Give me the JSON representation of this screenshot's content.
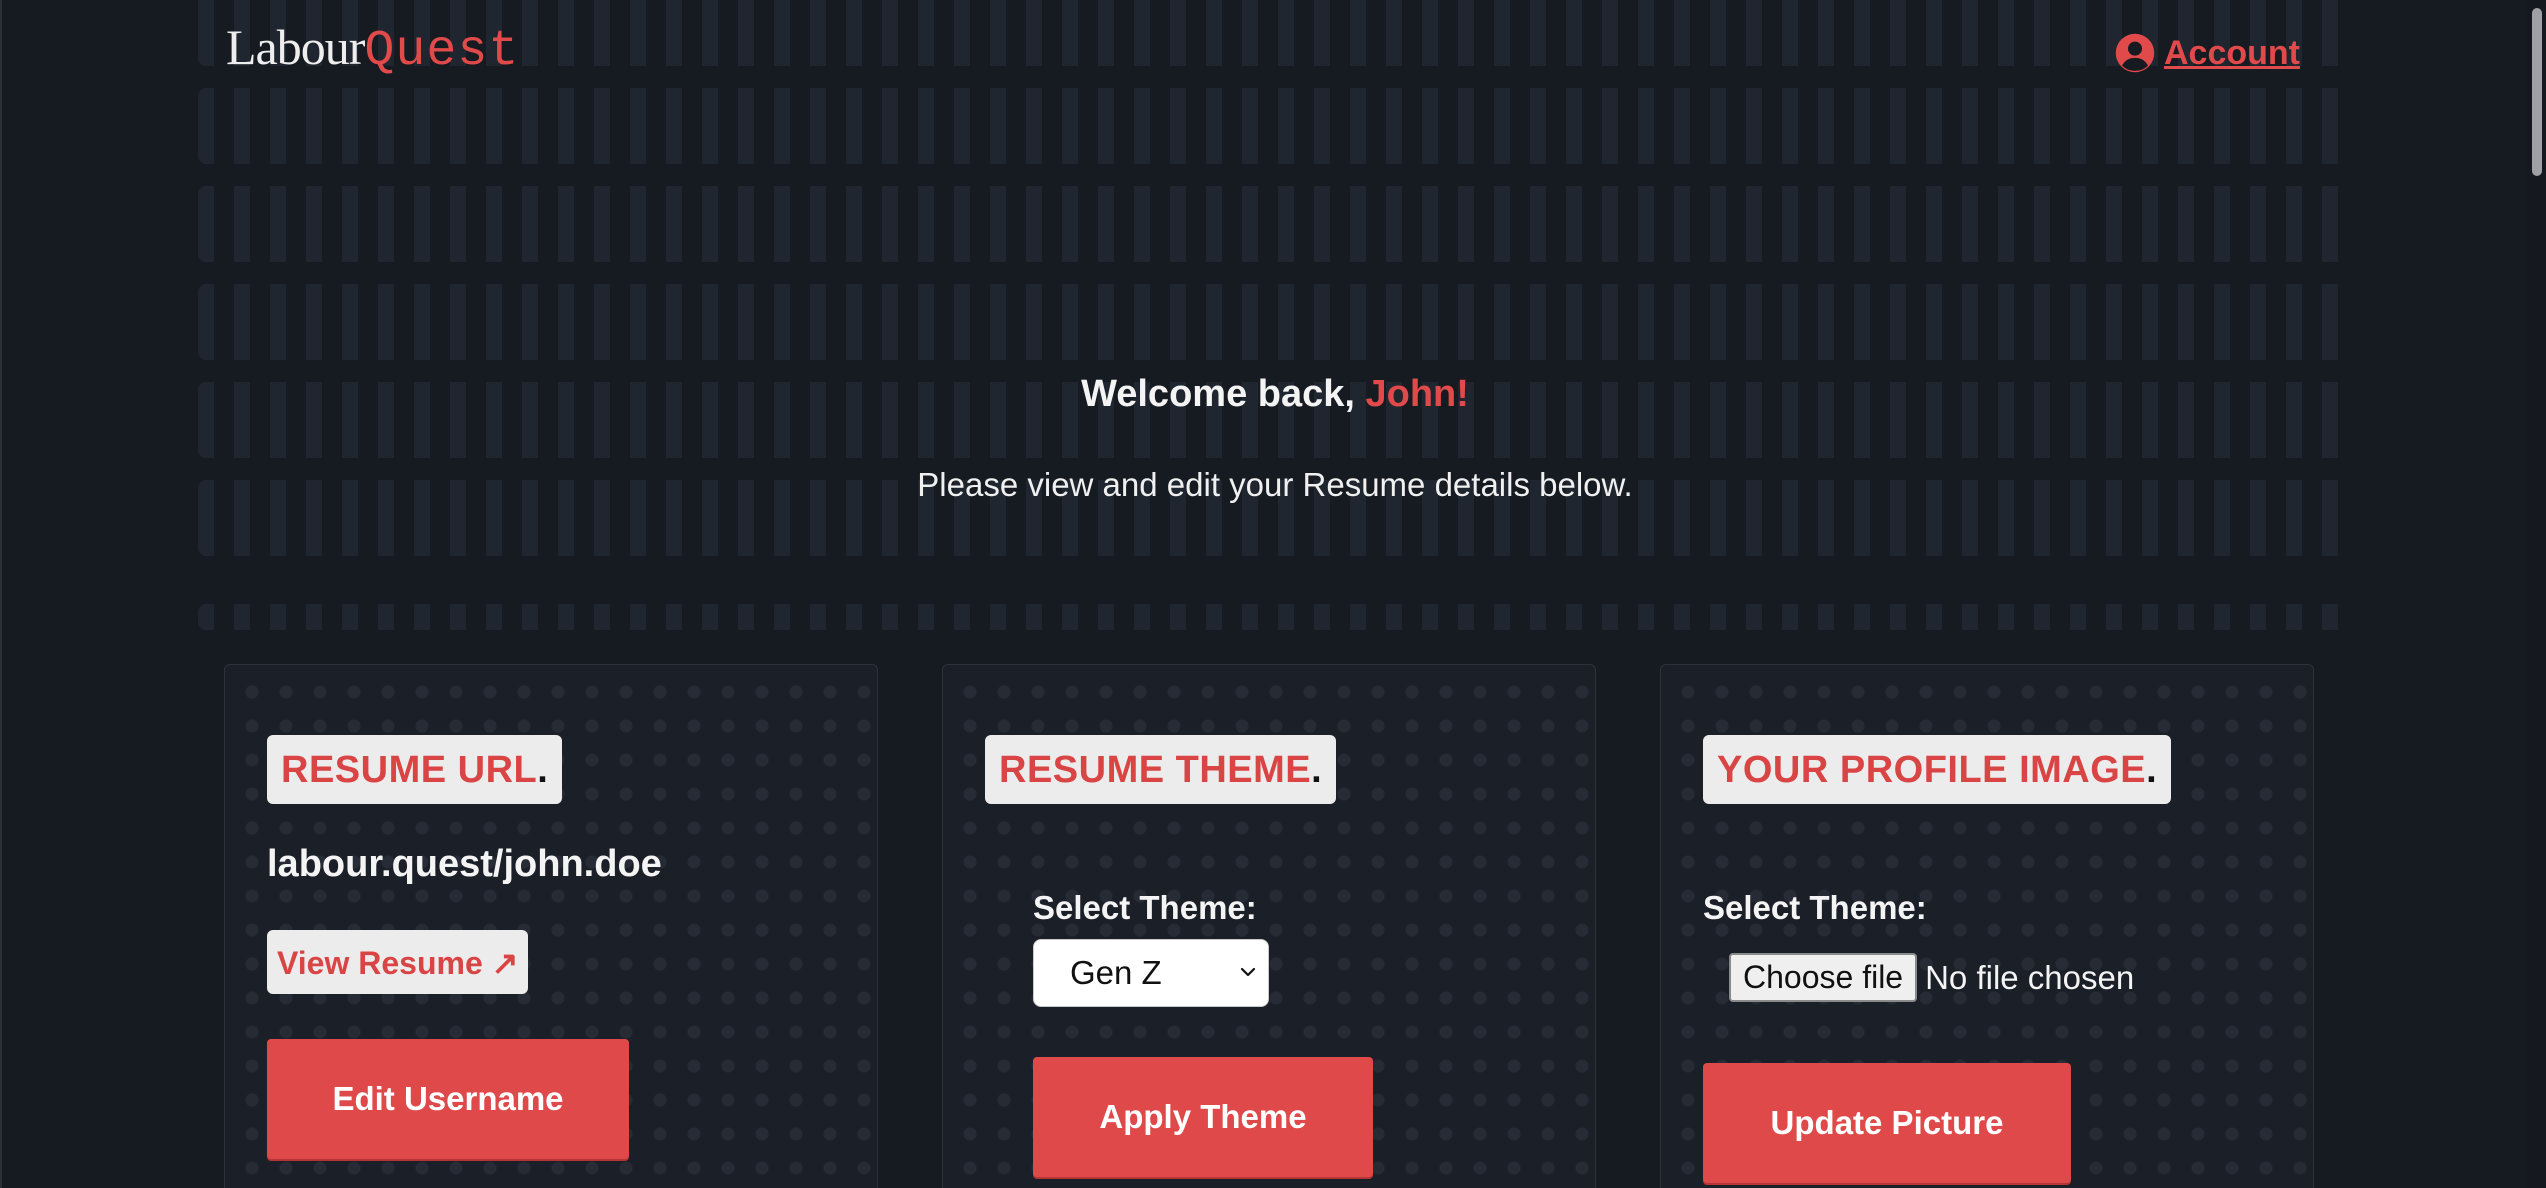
{
  "header": {
    "logo_part1": "Labour",
    "logo_part2": "Quest",
    "account_label": "Account",
    "account_icon": "user-circle-icon"
  },
  "hero": {
    "welcome_prefix": "Welcome back, ",
    "user_name": "John!",
    "subtext": "Please view and edit your Resume details below."
  },
  "cards": {
    "resume_url": {
      "heading": "RESUME URL",
      "heading_dot": ".",
      "url": "labour.quest/john.doe",
      "view_label": "View Resume ↗",
      "edit_label": "Edit Username"
    },
    "resume_theme": {
      "heading": "RESUME THEME",
      "heading_dot": ".",
      "select_label": "Select Theme:",
      "selected_theme": "Gen Z",
      "apply_label": "Apply Theme"
    },
    "profile_image": {
      "heading": "YOUR PROFILE IMAGE",
      "heading_dot": ".",
      "select_label": "Select Theme:",
      "file_button": "Choose file",
      "file_status": "No file chosen",
      "update_label": "Update Picture"
    }
  },
  "colors": {
    "accent": "#df4949",
    "background": "#161a21",
    "card_bg": "#1b1f27",
    "heading_bg": "#ececec"
  }
}
